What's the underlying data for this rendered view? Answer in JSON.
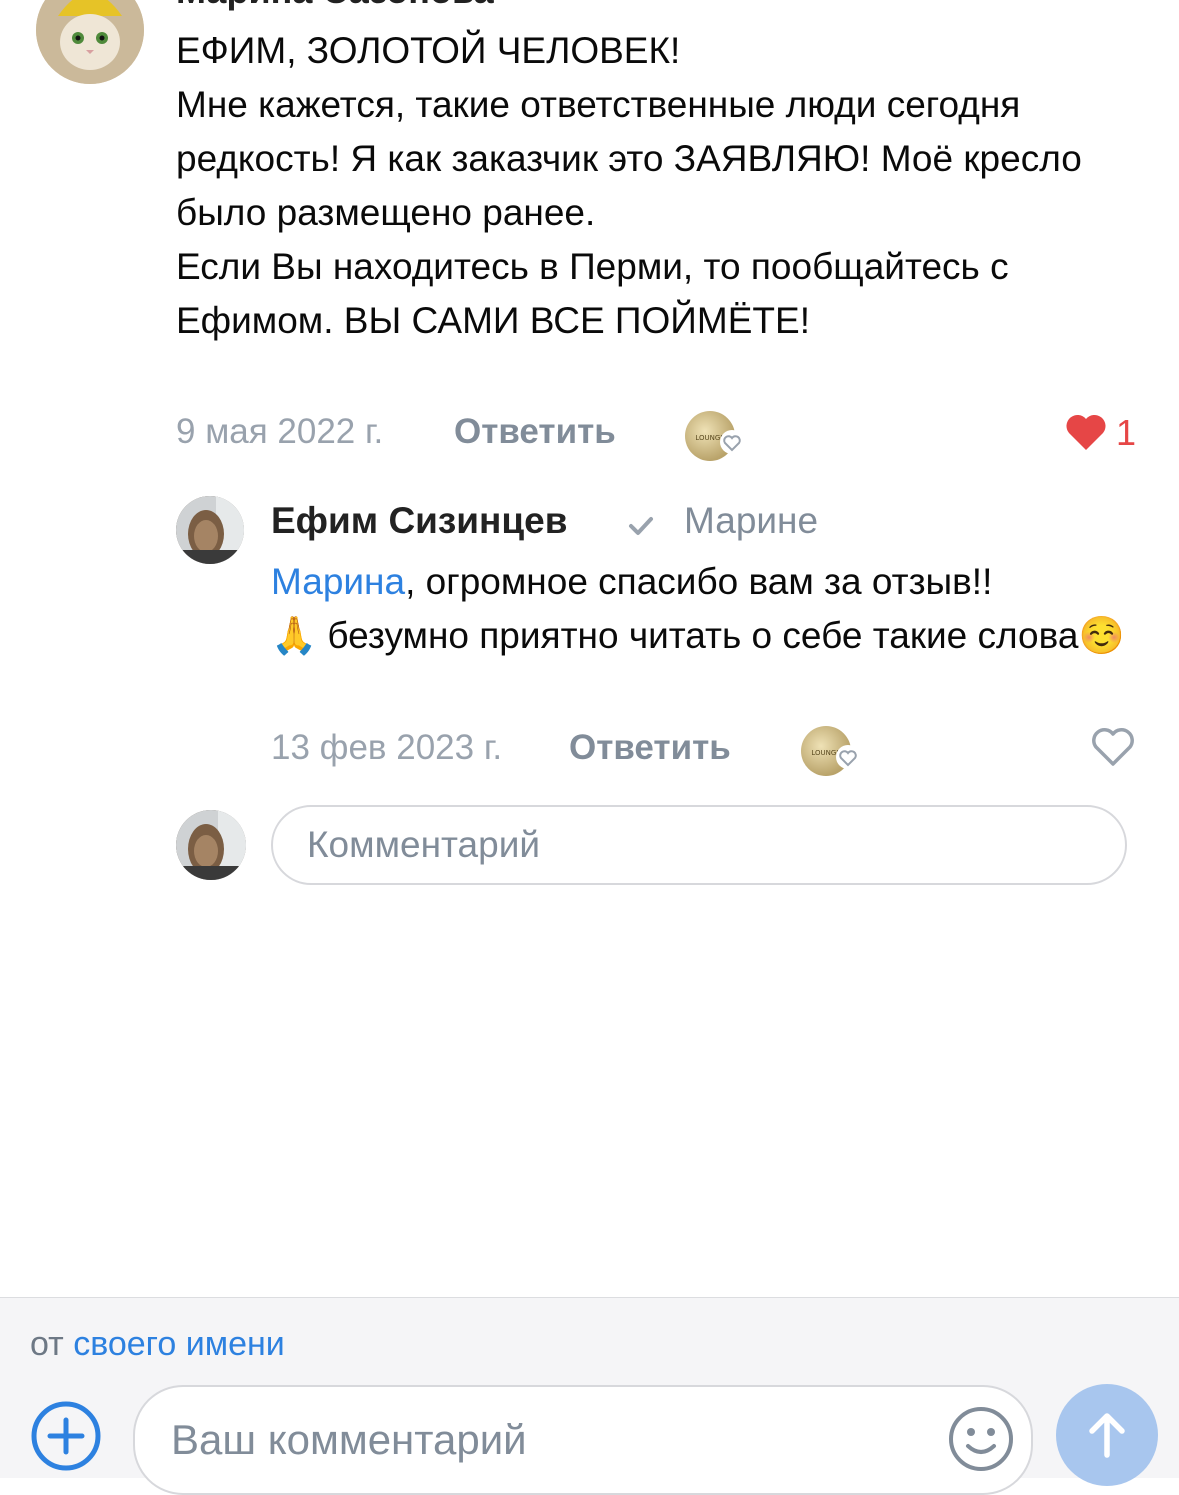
{
  "top_comment": {
    "author": "Марина Сазонова",
    "text": "ЕФИМ, ЗОЛОТОЙ ЧЕЛОВЕК!\nМне кажется, такие ответственные люди сегодня редкость! Я как заказчик это ЗАЯВЛЯЮ! Моё кресло было размещено ранее.\nЕсли Вы находитесь в Перми, то пообщайтесь с Ефимом. ВЫ САМИ ВСЕ ПОЙМЁТЕ!",
    "date": "9 мая 2022 г.",
    "reply_label": "Ответить",
    "badge_text": "LOUNGE",
    "like_count": "1",
    "liked": true
  },
  "reply": {
    "author": "Ефим Сизинцев",
    "reply_to": "Марине",
    "mention": "Марина",
    "text_line1": ", огромное спасибо вам за отзыв!!",
    "emoji_pray": "🙏",
    "text_line2": " безумно приятно читать о себе такие слова",
    "emoji_smile": "☺️",
    "date": "13 фев 2023 г.",
    "reply_label": "Ответить",
    "badge_text": "LOUNGE",
    "liked": false
  },
  "inline_comment": {
    "placeholder": "Комментарий"
  },
  "composer": {
    "from_prefix": "от",
    "from_link": "своего имени",
    "placeholder": "Ваш комментарий"
  },
  "colors": {
    "accent": "#2d81e0",
    "like": "#e64646",
    "muted": "#818c99",
    "send_disabled": "#a8c6ee"
  }
}
